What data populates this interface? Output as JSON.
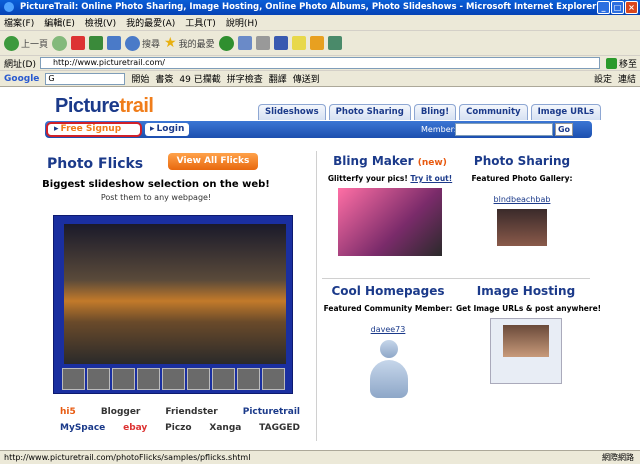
{
  "window": {
    "title": "PictureTrail: Online Photo Sharing, Image Hosting, Online Photo Albums, Photo Slideshows - Microsoft Internet Explorer",
    "buttons": [
      "_",
      "□",
      "×"
    ]
  },
  "menu": [
    "檔案(F)",
    "編輯(E)",
    "檢視(V)",
    "我的最愛(A)",
    "工具(T)",
    "說明(H)"
  ],
  "toolbar": {
    "back": "上一頁",
    "search": "搜尋",
    "favorites": "我的最愛"
  },
  "address": {
    "label": "網址(D)",
    "url": "http://www.picturetrail.com/",
    "go": "移至"
  },
  "googlebar": {
    "brand": "Google",
    "search_prefix": "G",
    "open": "開始",
    "bookmarks": "書簽",
    "blocked": "49 已攔截",
    "spellcheck": "拼字檢查",
    "translate": "翻譯",
    "sendto": "傳送到",
    "settings": "設定",
    "links": "連結"
  },
  "site": {
    "logo_a": "Picture",
    "logo_b": "trail",
    "tabs": [
      "Slideshows",
      "Photo Sharing",
      "Bling!",
      "Community",
      "Image URLs"
    ],
    "signup": "Free Signup",
    "login": "Login",
    "member_label": "Member:",
    "member_go": "Go"
  },
  "photo_flicks": {
    "title": "Photo Flicks",
    "view_all": "View All Flicks",
    "subtitle": "Biggest slideshow selection on the web!",
    "subtext": "Post them to any webpage!",
    "partners_row1": [
      "hi5",
      "Blogger",
      "Friendster",
      "Picturetrail"
    ],
    "partners_row2": [
      "MySpace",
      "ebay",
      "Piczo",
      "Xanga",
      "TAGGED"
    ]
  },
  "bling": {
    "title": "Bling Maker",
    "badge": "(new)",
    "desc": "Glitterfy your pics!",
    "link": "Try it out!"
  },
  "sharing": {
    "title": "Photo Sharing",
    "desc": "Featured Photo Gallery:",
    "user": "blndbeachbab"
  },
  "homepages": {
    "title": "Cool Homepages",
    "desc": "Featured Community Member:",
    "user": "davee73"
  },
  "hosting": {
    "title": "Image Hosting",
    "desc": "Get Image URLs & post anywhere!"
  },
  "status": {
    "url": "http://www.picturetrail.com/photoFlicks/samples/pflicks.shtml",
    "zone": "網際網路"
  }
}
